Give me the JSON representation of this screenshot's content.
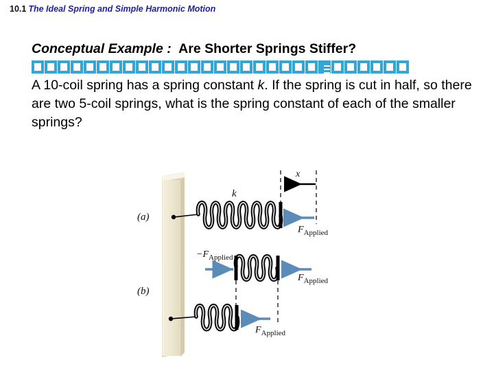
{
  "header": {
    "section_number": "10.1",
    "section_title": "The Ideal Spring and Simple Harmonic Motion"
  },
  "content": {
    "example_label": "Conceptual Example",
    "example_colon": ":",
    "example_question": "Are Shorter Springs Stiffer?",
    "missing_glyph_count": 29,
    "missing_glyph_filled_index": 22,
    "missing_glyph_color": "#33a6d4",
    "body_part1": "A 10-coil spring has a spring constant ",
    "body_italic1": "k",
    "body_part2": ".  If the spring is cut in half, so there are two 5-coil springs, what is the spring constant of each of the smaller springs?"
  },
  "figure": {
    "label_a": "(a)",
    "label_b": "(b)",
    "spring_constant_label": "k",
    "displacement_label": "x",
    "force_symbol": "F",
    "force_subscript": "Applied",
    "force_neg_symbol": "−F",
    "wall_color": "#ece5cf",
    "wall_edge_color": "#f7f3e4",
    "wall_shadow_color": "#d6ccae",
    "arrow_blue": "#5b8cb8",
    "arrow_black": "#000000",
    "parts": [
      {
        "id": "a",
        "description": "Ten-coil spring attached to wall, compressed by applied force through displacement x",
        "coil_count": 10,
        "forces": [
          "F Applied"
        ]
      },
      {
        "id": "b",
        "description": "Two five-coil springs: upper free spring with equal and opposite forces, lower spring attached to wall",
        "coil_count": 5,
        "forces": [
          "−F Applied",
          "F Applied",
          "F Applied"
        ]
      }
    ]
  }
}
